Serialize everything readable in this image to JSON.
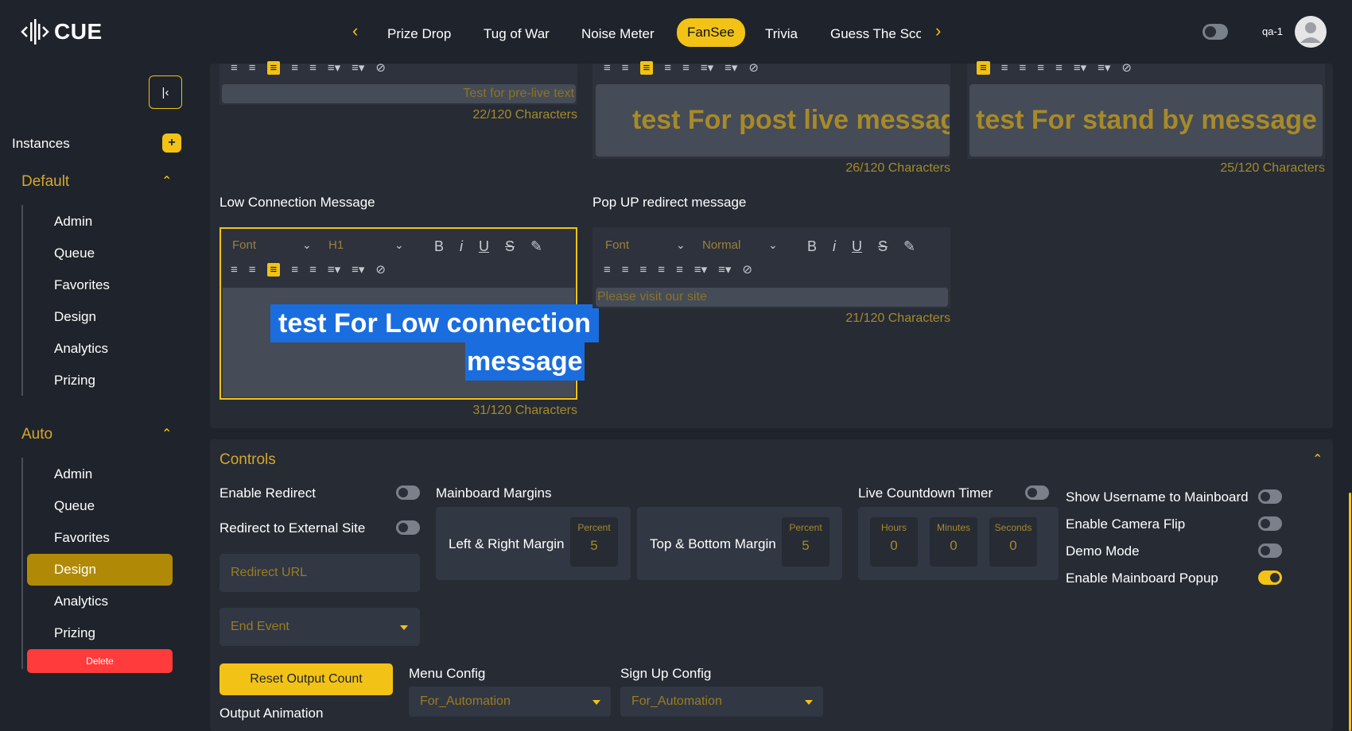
{
  "brand": {
    "name": "CUE"
  },
  "nav": {
    "tabs": [
      "Prize Drop",
      "Tug of War",
      "Noise Meter",
      "FanSee",
      "Trivia",
      "Guess The Sco"
    ],
    "active": "FanSee"
  },
  "user": {
    "name": "qa-1"
  },
  "sidebar": {
    "instances_label": "Instances",
    "add_symbol": "+",
    "groups": [
      {
        "name": "Default",
        "items": [
          "Admin",
          "Queue",
          "Favorites",
          "Design",
          "Analytics",
          "Prizing"
        ]
      },
      {
        "name": "Auto",
        "items": [
          "Admin",
          "Queue",
          "Favorites",
          "Design",
          "Analytics",
          "Prizing"
        ]
      }
    ],
    "delete_label": "Delete"
  },
  "editors": {
    "prelive": {
      "text": "Test for pre-live text",
      "count": "22/120 Characters"
    },
    "postlive": {
      "text": "test For post live message",
      "count": "26/120 Characters"
    },
    "standby": {
      "text": "test For stand by message",
      "count": "25/120 Characters"
    },
    "lowconn": {
      "label": "Low Connection Message",
      "font": "Font",
      "size": "H1",
      "line1": "test For Low connection",
      "line2": "message",
      "count": "31/120 Characters"
    },
    "popup": {
      "label": "Pop UP redirect message",
      "font": "Font",
      "size": "Normal",
      "text": "Please visit our site",
      "count": "21/120 Characters"
    }
  },
  "toolbar": {
    "bold": "B",
    "italic": "i",
    "underline": "U",
    "strike": "S"
  },
  "controls": {
    "title": "Controls",
    "enable_redirect": "Enable Redirect",
    "redirect_external": "Redirect to External Site",
    "redirect_url_placeholder": "Redirect URL",
    "end_event_placeholder": "End Event",
    "mainboard_margins": "Mainboard Margins",
    "left_right_margin": "Left & Right Margin",
    "top_bottom_margin": "Top & Bottom Margin",
    "percent_label": "Percent",
    "left_right_value": "5",
    "top_bottom_value": "5",
    "live_countdown": "Live Countdown Timer",
    "hours": "Hours",
    "minutes": "Minutes",
    "seconds": "Seconds",
    "hours_value": "0",
    "minutes_value": "0",
    "seconds_value": "0",
    "show_username": "Show Username to Mainboard",
    "enable_camera_flip": "Enable Camera Flip",
    "demo_mode": "Demo Mode",
    "enable_mainboard_popup": "Enable Mainboard Popup",
    "reset_output_count": "Reset Output Count",
    "output_animation": "Output Animation",
    "menu_config": "Menu Config",
    "menu_config_value": "For_Automation",
    "signup_config": "Sign Up Config",
    "signup_config_value": "For_Automation"
  },
  "colors": {
    "accent": "#f2c316",
    "background": "#1f232b",
    "panel": "#262b34",
    "danger": "#ff3b3b"
  }
}
